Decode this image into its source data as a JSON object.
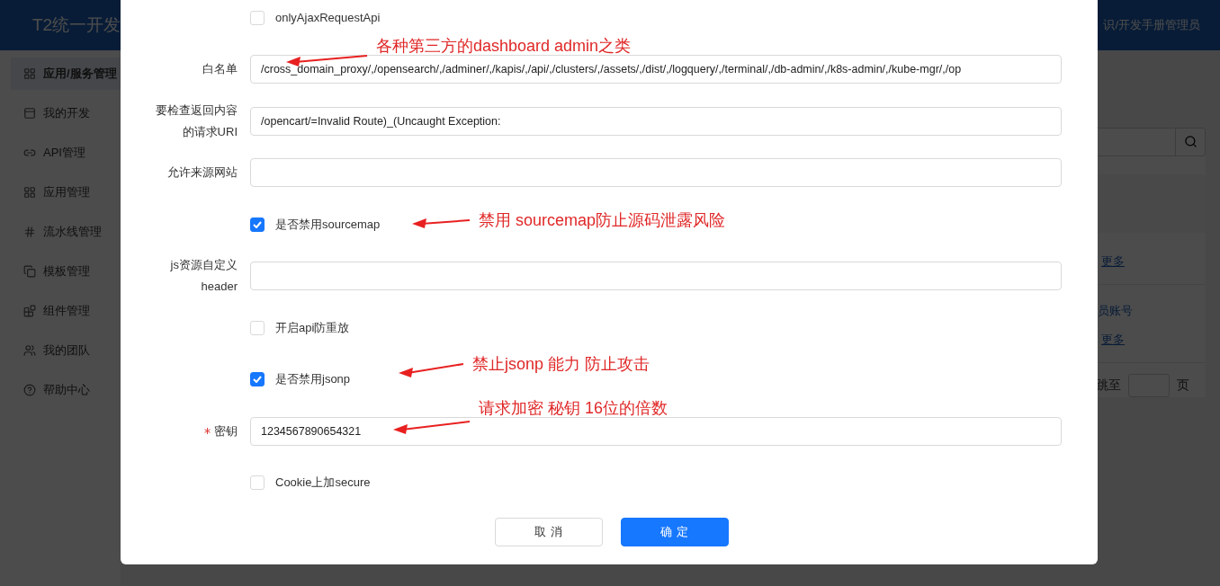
{
  "header": {
    "title": "T2统一开发",
    "user": "识/开发手册管理员"
  },
  "sidebar": {
    "items": [
      {
        "label": "应用/服务管理",
        "selected": true
      },
      {
        "label": "我的开发",
        "selected": false
      },
      {
        "label": "API管理",
        "selected": false
      },
      {
        "label": "应用管理",
        "selected": false
      },
      {
        "label": "流水线管理",
        "selected": false
      },
      {
        "label": "模板管理",
        "selected": false
      },
      {
        "label": "组件管理",
        "selected": false
      },
      {
        "label": "我的团队",
        "selected": false
      },
      {
        "label": "帮助中心",
        "selected": false
      }
    ]
  },
  "right_panel": {
    "links": [
      "更多",
      "员账号",
      "更多"
    ],
    "jump": {
      "label": "跳至",
      "suffix": "页"
    }
  },
  "dialog": {
    "rows": [
      {
        "kind": "checkbox",
        "label": "onlyAjaxRequestApi",
        "checked": false
      },
      {
        "kind": "field",
        "label": "白名单",
        "value": "/cross_domain_proxy/,/opensearch/,/adminer/,/kapis/,/api/,/clusters/,/assets/,/dist/,/logquery/,/terminal/,/db-admin/,/k8s-admin/,/kube-mgr/,/op"
      },
      {
        "kind": "field",
        "label": "要检查返回内容的请求URI",
        "value": "/opencart/=Invalid Route)_(Uncaught Exception:"
      },
      {
        "kind": "field",
        "label": "允许来源网站"
      },
      {
        "kind": "checkbox",
        "label": "是否禁用sourcemap",
        "checked": true
      },
      {
        "kind": "field",
        "label": "js资源自定义header"
      },
      {
        "kind": "checkbox",
        "label": "开启api防重放",
        "checked": false
      },
      {
        "kind": "checkbox",
        "label": "是否禁用jsonp",
        "checked": true
      },
      {
        "kind": "field",
        "label": "密钥",
        "value": "1234567890654321",
        "required": true
      },
      {
        "kind": "checkbox",
        "label": "Cookie上加secure",
        "checked": false
      }
    ],
    "buttons": [
      {
        "label": "取 消",
        "kind": "default"
      },
      {
        "label": "确 定",
        "kind": "primary"
      }
    ]
  },
  "annotations": [
    "各种第三方的dashboard admin之类",
    "禁用 sourcemap防止源码泄露风险",
    "禁止jsonp 能力 防止攻击",
    "请求加密 秘钥 16位的倍数"
  ]
}
